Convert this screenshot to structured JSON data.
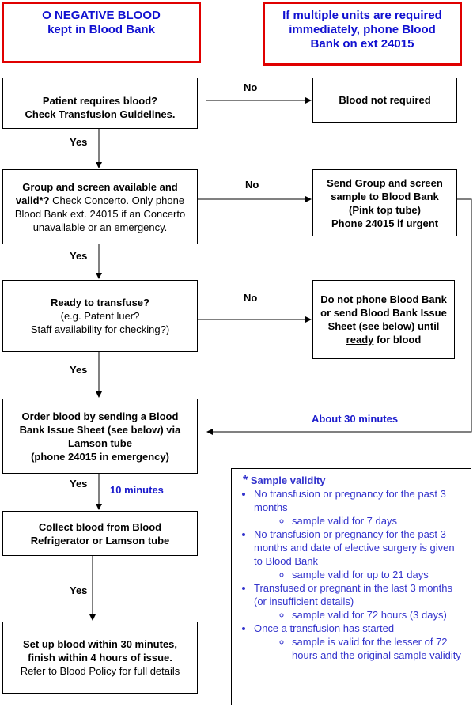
{
  "notes": {
    "o_negative": [
      "O NEGATIVE BLOOD",
      "kept in Blood Bank"
    ],
    "multiple_units": [
      "If multiple units are required",
      "immediately, phone Blood",
      "Bank on ext 24015"
    ]
  },
  "steps": {
    "patient_requires": [
      "Patient requires blood?",
      "Check Transfusion Guidelines."
    ],
    "group_screen": {
      "bold": "Group and screen available and valid*?",
      "rest": " Check Concerto. Only phone Blood Bank ext. 24015 if an Concerto unavailable  or an emergency."
    },
    "ready": {
      "bold": "Ready to transfuse?",
      "lines": [
        "(e.g. Patent luer?",
        "Staff availability  for checking?)"
      ]
    },
    "order": [
      "Order blood by sending a Blood",
      "Bank Issue Sheet (see below) via",
      "Lamson tube",
      "(phone 24015 in emergency)"
    ],
    "collect": [
      "Collect blood from Blood",
      "Refrigerator or Lamson tube"
    ],
    "setup": {
      "bold": [
        "Set up blood within 30 minutes,",
        "finish within 4 hours of issue."
      ],
      "rest": "Refer to Blood Policy for full details"
    }
  },
  "outcomes": {
    "not_required": "Blood not required",
    "send_sample": [
      "Send Group and screen",
      "sample to Blood Bank",
      "(Pink top tube)",
      "Phone 24015 if urgent"
    ],
    "do_not_phone": {
      "before": "Do not phone Blood Bank or send Blood Bank Issue Sheet (see below) ",
      "underlined": "until ready",
      "after": " for blood"
    }
  },
  "labels": {
    "no": "No",
    "yes": "Yes",
    "about_30": "About 30 minutes",
    "ten_min": "10 minutes"
  },
  "validity": {
    "star": "*",
    "title": "Sample validity",
    "items": [
      {
        "text": "No transfusion or pregnancy for the past 3 months",
        "sub": "sample valid  for 7 days"
      },
      {
        "text": "No transfusion or pregnancy for the past 3 months and date of elective surgery is given to Blood Bank",
        "sub": "sample valid  for up to 21 days"
      },
      {
        "text": "Transfused or pregnant in the last 3 months (or insufficient details)",
        "sub": "sample valid  for 72 hours (3 days)"
      },
      {
        "text": "Once a transfusion has started",
        "sub": "sample is valid for the lesser of 72 hours and the original sample validity"
      }
    ]
  },
  "colors": {
    "warning_border": "#e00000",
    "note_text": "#1010d0",
    "validity_text": "#3333cc"
  }
}
